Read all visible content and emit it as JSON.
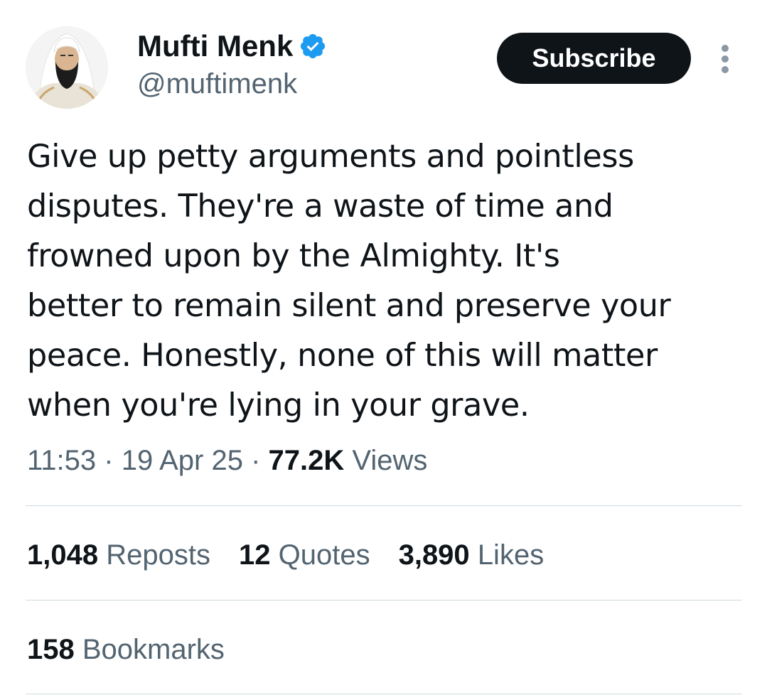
{
  "author": {
    "display_name": "Mufti Menk",
    "handle": "@muftimenk",
    "verified": true
  },
  "header": {
    "subscribe_label": "Subscribe"
  },
  "tweet": {
    "text": "Give up petty arguments and pointless\ndisputes. They're a waste of time and\nfrowned upon by the Almighty. It's\nbetter to remain silent and preserve your\npeace. Honestly, none of this will matter\nwhen you're lying in your grave.",
    "time": "11:53",
    "separator": "·",
    "date": "19 Apr 25",
    "views_count": "77.2K",
    "views_label": "Views"
  },
  "stats": {
    "reposts_count": "1,048",
    "reposts_label": "Reposts",
    "quotes_count": "12",
    "quotes_label": "Quotes",
    "likes_count": "3,890",
    "likes_label": "Likes",
    "bookmarks_count": "158",
    "bookmarks_label": "Bookmarks"
  },
  "icons": {
    "verified": "verified-badge-icon",
    "more": "more-options-icon"
  },
  "colors": {
    "verified_blue": "#1d9bf0",
    "primary_text": "#0f1419",
    "secondary_text": "#536471",
    "divider": "#cfd9de",
    "button_bg": "#0f1419"
  }
}
